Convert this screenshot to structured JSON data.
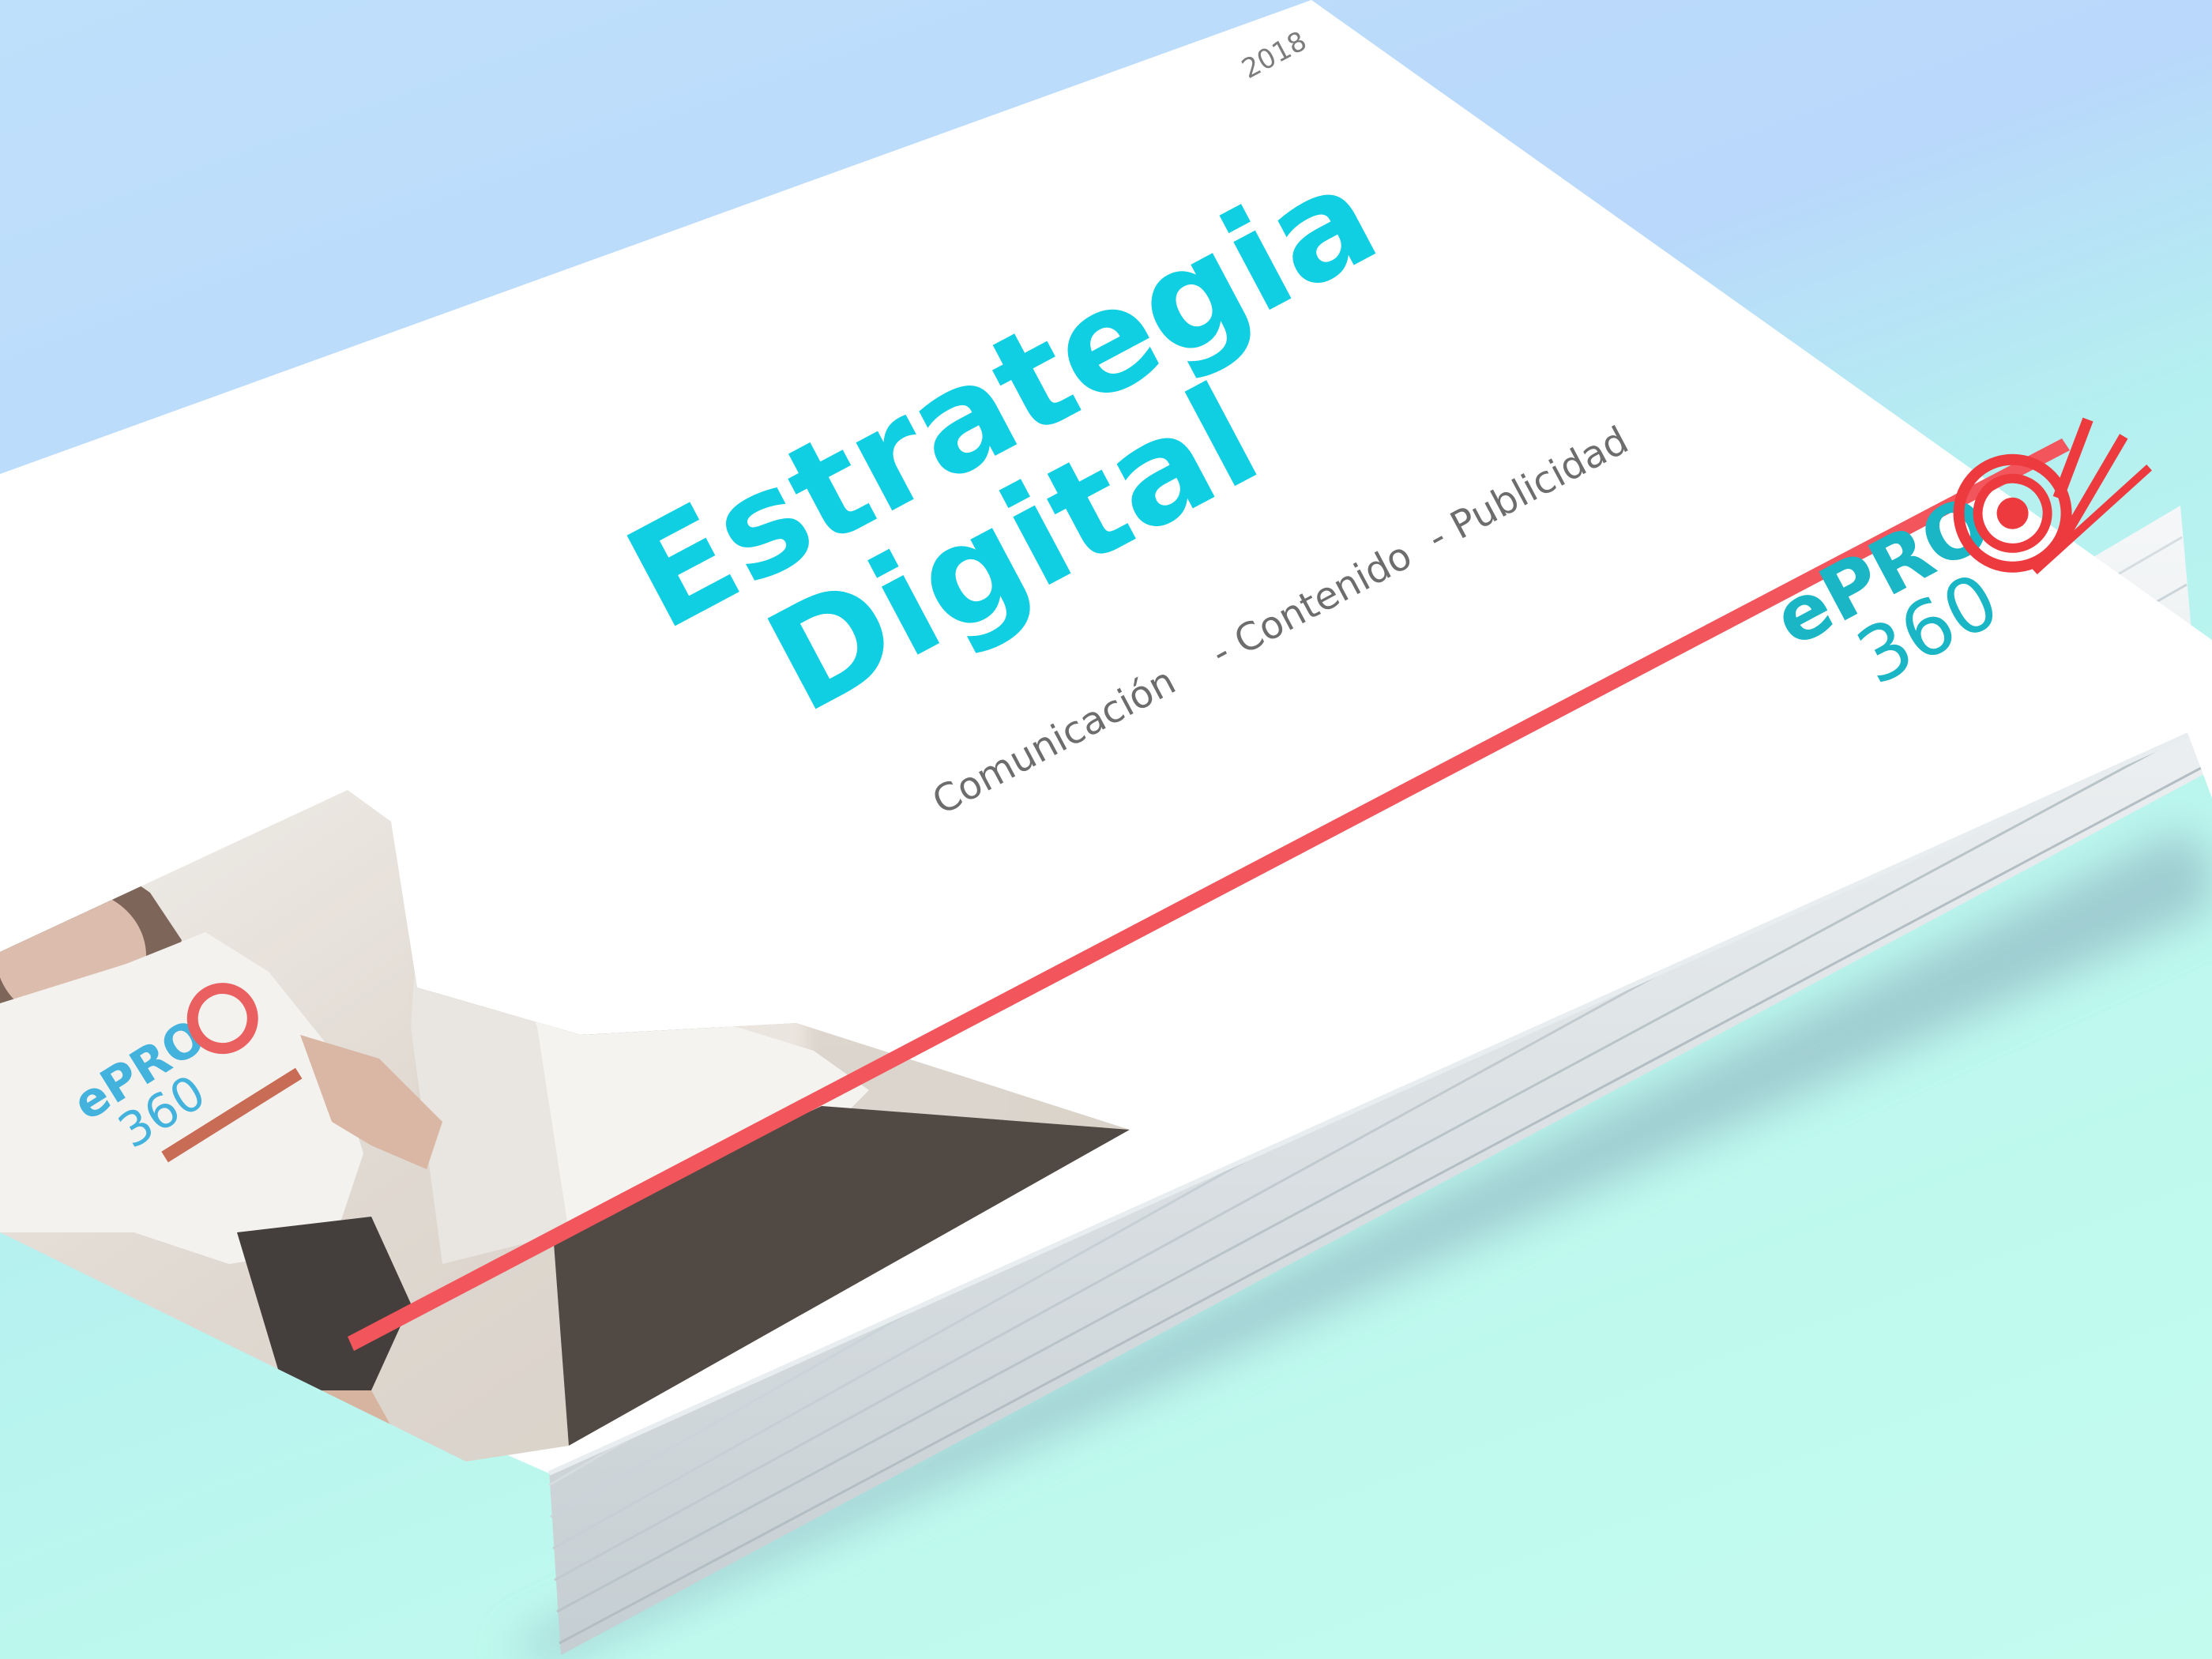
{
  "brochure": {
    "year": "2018",
    "title_line1": "Estrategia",
    "title_line2": "Digital",
    "subtitle_part1": "Comunicación",
    "subtitle_part2": "- Contenido",
    "subtitle_part3": "- Publicidad"
  },
  "logo": {
    "line1": "ePRO",
    "line2": "360",
    "mark_icon": "at-sign-spiral-icon"
  },
  "shirt_logo_text": {
    "line1": "ePRO",
    "line2": "360"
  },
  "colors": {
    "title_cyan": "#10cfe2",
    "stripe_red": "#f2555b",
    "logo_red": "#ec3a3f",
    "logo_teal": "#1ab6c6",
    "subtitle_gray": "#6d6d6d",
    "page_white": "#ffffff",
    "bg_blue": "#bddcfb",
    "bg_mint": "#c0faee"
  }
}
